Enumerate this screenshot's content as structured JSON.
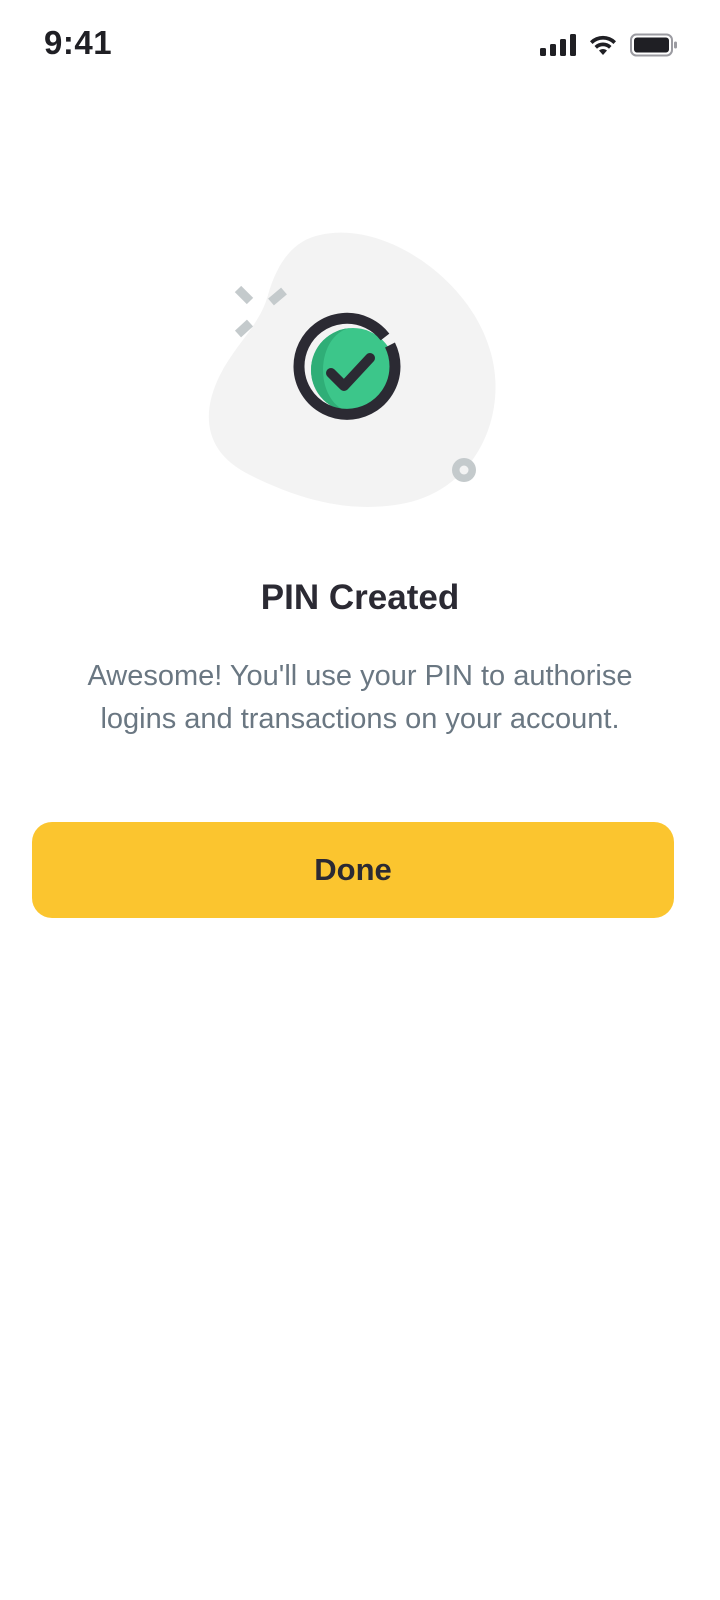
{
  "status_bar": {
    "time": "9:41",
    "icons": [
      "cellular-signal-icon",
      "wifi-icon",
      "battery-icon"
    ]
  },
  "illustration": {
    "icon": "success-check-icon",
    "colors": {
      "blob": "#f3f3f3",
      "ring": "#2b2a33",
      "check_fill": "#3cc68a",
      "check_shade": "#2fae77",
      "sparkles": "#c4cacc",
      "dot": "#c4cacc"
    }
  },
  "content": {
    "title": "PIN Created",
    "message": "Awesome! You'll use your PIN to authorise logins and transactions on your account."
  },
  "actions": {
    "done_label": "Done"
  },
  "theme": {
    "primary": "#fbc52f",
    "text_dark": "#2b2a33",
    "text_muted": "#6a7782",
    "background": "#ffffff"
  }
}
